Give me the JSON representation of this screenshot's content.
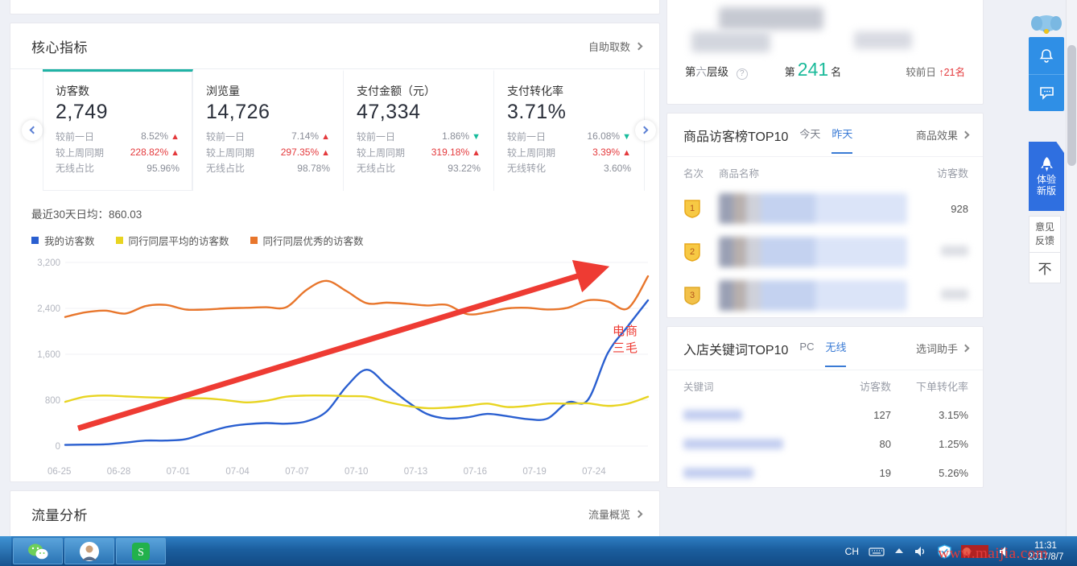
{
  "core": {
    "title": "核心指标",
    "link": "自助取数",
    "metrics": [
      {
        "name": "访客数",
        "value": "2,749",
        "rows": [
          {
            "label": "较前一日",
            "value": "8.52%",
            "dir": "up",
            "hl": false
          },
          {
            "label": "较上周同期",
            "value": "228.82%",
            "dir": "up",
            "hl": true
          },
          {
            "label": "无线占比",
            "value": "95.96%",
            "dir": "",
            "hl": false
          }
        ]
      },
      {
        "name": "浏览量",
        "value": "14,726",
        "rows": [
          {
            "label": "较前一日",
            "value": "7.14%",
            "dir": "up",
            "hl": false
          },
          {
            "label": "较上周同期",
            "value": "297.35%",
            "dir": "up",
            "hl": true
          },
          {
            "label": "无线占比",
            "value": "98.78%",
            "dir": "",
            "hl": false
          }
        ]
      },
      {
        "name": "支付金额（元）",
        "value": "47,334",
        "rows": [
          {
            "label": "较前一日",
            "value": "1.86%",
            "dir": "down",
            "hl": false
          },
          {
            "label": "较上周同期",
            "value": "319.18%",
            "dir": "up",
            "hl": true
          },
          {
            "label": "无线占比",
            "value": "93.22%",
            "dir": "",
            "hl": false
          }
        ]
      },
      {
        "name": "支付转化率",
        "value": "3.71%",
        "rows": [
          {
            "label": "较前一日",
            "value": "16.08%",
            "dir": "down",
            "hl": false
          },
          {
            "label": "较上周同期",
            "value": "3.39%",
            "dir": "up",
            "hl": true
          },
          {
            "label": "无线转化",
            "value": "3.60%",
            "dir": "",
            "hl": false
          }
        ]
      }
    ]
  },
  "chart_data": {
    "type": "line",
    "title": "最近30天日均：860.03",
    "annotation": "电商三毛",
    "xlabel": "",
    "ylabel": "",
    "ylim": [
      0,
      3200
    ],
    "yticks": [
      3200,
      2400,
      1600,
      800,
      0
    ],
    "ytick_labels": [
      "3,200",
      "2,400",
      "1,600",
      "800",
      "0"
    ],
    "grid": true,
    "legend_position": "top-left",
    "x": [
      "06-25",
      "06-26",
      "06-27",
      "06-28",
      "06-29",
      "06-30",
      "07-01",
      "07-02",
      "07-03",
      "07-04",
      "07-05",
      "07-06",
      "07-07",
      "07-08",
      "07-09",
      "07-10",
      "07-11",
      "07-12",
      "07-13",
      "07-14",
      "07-15",
      "07-16",
      "07-17",
      "07-18",
      "07-19",
      "07-20",
      "07-21",
      "07-22",
      "07-23",
      "07-24"
    ],
    "xtick_labels": [
      "06-25",
      "06-28",
      "07-01",
      "07-04",
      "07-07",
      "07-10",
      "07-13",
      "07-16",
      "07-19",
      "07-24"
    ],
    "series": [
      {
        "name": "我的访客数",
        "color": "#2a5fd0",
        "values": [
          20,
          25,
          30,
          60,
          95,
          95,
          120,
          230,
          330,
          380,
          400,
          390,
          430,
          600,
          1040,
          1330,
          1060,
          780,
          560,
          480,
          500,
          560,
          520,
          470,
          480,
          760,
          800,
          1620,
          2090,
          2540
        ]
      },
      {
        "name": "同行同层平均的访客数",
        "color": "#e8d421",
        "values": [
          770,
          860,
          880,
          865,
          850,
          840,
          835,
          830,
          800,
          760,
          790,
          860,
          880,
          880,
          870,
          860,
          770,
          700,
          660,
          670,
          700,
          740,
          680,
          700,
          740,
          740,
          745,
          700,
          740,
          860
        ]
      },
      {
        "name": "同行同层优秀的访客数",
        "color": "#e8762c",
        "values": [
          2250,
          2330,
          2360,
          2310,
          2440,
          2460,
          2380,
          2380,
          2400,
          2410,
          2420,
          2420,
          2720,
          2880,
          2700,
          2490,
          2500,
          2480,
          2450,
          2460,
          2300,
          2330,
          2400,
          2410,
          2380,
          2410,
          2540,
          2520,
          2400,
          2960
        ]
      }
    ]
  },
  "traffic": {
    "title": "流量分析",
    "link": "流量概览"
  },
  "shop": {
    "tier_prefix": "第",
    "tier_value": "六",
    "tier_suffix": "层级",
    "rank_prefix": "第",
    "rank_value": "241",
    "rank_suffix": "名",
    "delta_label": "较前日",
    "delta_value": "21名",
    "delta_arrow": "↑"
  },
  "product_panel": {
    "title": "商品访客榜TOP10",
    "tabs": [
      {
        "label": "今天",
        "active": false
      },
      {
        "label": "昨天",
        "active": true
      }
    ],
    "link": "商品效果",
    "columns": [
      "名次",
      "商品名称",
      "访客数"
    ],
    "rows": [
      {
        "rank": "1",
        "visitors": "928",
        "blurred": false
      },
      {
        "rank": "2",
        "visitors": "",
        "blurred": true
      },
      {
        "rank": "3",
        "visitors": "",
        "blurred": true
      }
    ]
  },
  "keyword_panel": {
    "title": "入店关键词TOP10",
    "tabs": [
      {
        "label": "PC",
        "active": false
      },
      {
        "label": "无线",
        "active": true
      }
    ],
    "link": "选词助手",
    "columns": [
      "关键词",
      "访客数",
      "下单转化率"
    ],
    "rows": [
      {
        "visitors": "127",
        "rate": "3.15%"
      },
      {
        "visitors": "80",
        "rate": "1.25%"
      },
      {
        "visitors": "19",
        "rate": "5.26%"
      }
    ]
  },
  "edge_toolbar": {
    "new_version_line1": "体验",
    "new_version_line2": "新版",
    "feedback_line1": "意见",
    "feedback_line2": "反馈",
    "collapse": "不"
  },
  "taskbar": {
    "ime": "CH",
    "time": "11:31",
    "date": "2017/8/7",
    "watermark": "www.maijia.com"
  }
}
